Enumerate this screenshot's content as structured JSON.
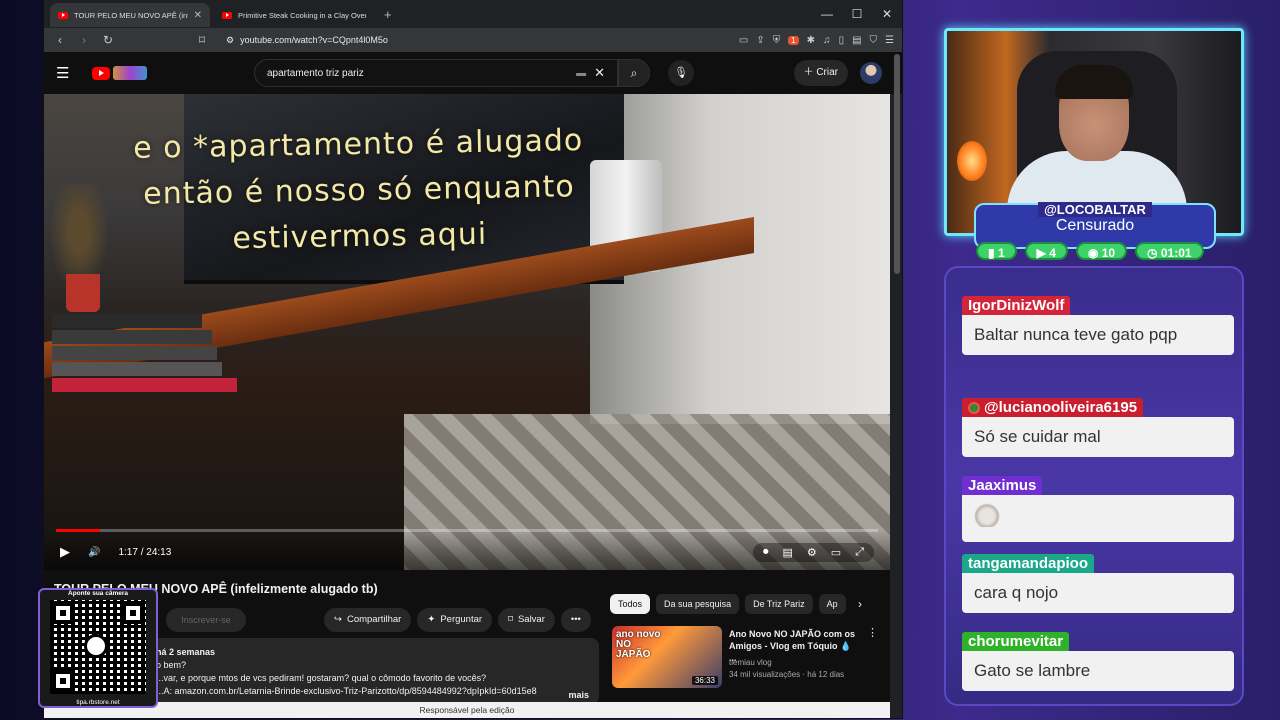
{
  "browser": {
    "tabs": [
      {
        "title": "TOUR PELO MEU NOVO APÊ (infelizmente alugado tb) - YouTube",
        "active": true
      },
      {
        "title": "Primitive Steak Cooking in a Clay Oven Built",
        "active": false
      }
    ],
    "url": "youtube.com/watch?v=CQpnt4l0M5o",
    "ext_badge": "1"
  },
  "youtube": {
    "search_query": "apartamento triz pariz",
    "create_label": "Criar",
    "subtitle_lines": [
      "e o *apartamento é alugado",
      "então é nosso só enquanto",
      "estivermos aqui"
    ],
    "time": "1:17 / 24:13",
    "progress": 0.053,
    "video_title": "TOUR PELO MEU NOVO APÊ (infelizmente alugado tb)",
    "subscribe_label": "Inscrever-se",
    "actions": [
      "Compartilhar",
      "Perguntar",
      "Salvar"
    ],
    "desc_date": "há 2 semanas",
    "desc_lines": [
      "o bem?",
      "...var, e porque mtos de vcs pediram! gostaram? qual o cômodo favorito de vocês?",
      "...A: amazon.com.br/Letarnia-Brinde-exclusivo-Triz-Parizotto/dp/8594484992?dpIpkId=60d15e8"
    ],
    "desc_more": "mais",
    "footer": "Responsável pela edição",
    "chips": [
      "Todos",
      "Da sua pesquisa",
      "De Triz Pariz",
      "Ap"
    ],
    "rec": {
      "thumb_text": "ano novo NO JAPÃO",
      "duration": "36:33",
      "title": "Ano Novo NO JAPÃO com os Amigos - Vlog em Tóquio 💧 ...",
      "channel": "tiemiau vlog",
      "meta": "34 mil visualizações · há 12 dias"
    }
  },
  "qr": {
    "caption": "Aponte sua câmera",
    "footer": "tipa.rbstore.net"
  },
  "stream": {
    "nickname": "@LOCOBALTAR",
    "status": "Censurado",
    "stats": [
      "1",
      "4",
      "10",
      "01:01"
    ]
  },
  "chat": [
    {
      "user": "IgorDinizWolf",
      "color": "#d3243a",
      "text": "Baltar nunca teve gato pqp"
    },
    {
      "user": "@lucianooliveira6195",
      "color": "#c81e2f",
      "text": "Só se cuidar mal"
    },
    {
      "user": "Jaaximus",
      "color": "#6f2fd0",
      "text": ""
    },
    {
      "user": "tangamandapioo",
      "color": "#1aa889",
      "text": "cara q nojo"
    },
    {
      "user": "chorumevitar",
      "color": "#2fb22a",
      "text": "Gato se lambre"
    }
  ],
  "colors": {
    "cam_border": "#6ee7ff",
    "stat_green": "#3ed36a",
    "chat_bg": "#3a2d8c",
    "yt_red": "#ff0000"
  }
}
